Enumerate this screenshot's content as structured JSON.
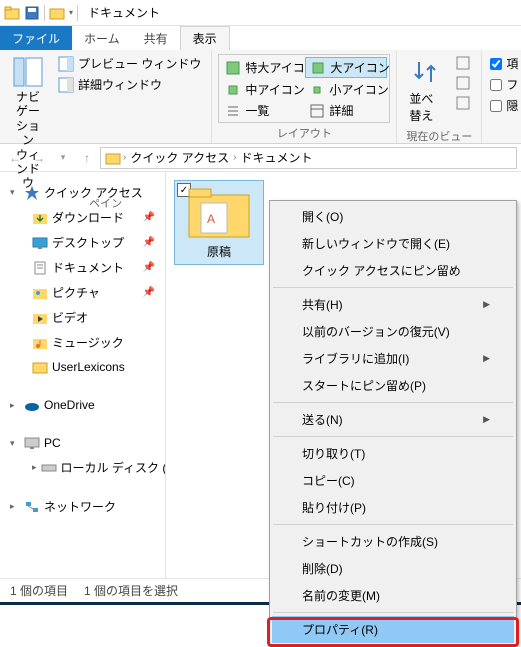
{
  "titlebar": {
    "title": "ドキュメント"
  },
  "tabs": {
    "file": "ファイル",
    "home": "ホーム",
    "share": "共有",
    "view": "表示"
  },
  "ribbon": {
    "pane": {
      "nav": "ナビゲーション\nウィンドウ",
      "preview": "プレビュー ウィンドウ",
      "details": "詳細ウィンドウ",
      "label": "ペイン"
    },
    "layout": {
      "xl": "特大アイコン",
      "l": "大アイコン",
      "m": "中アイコン",
      "s": "小アイコン",
      "list": "一覧",
      "details": "詳細",
      "label": "レイアウト"
    },
    "sort": {
      "button": "並べ替え",
      "label": "現在のビュー"
    },
    "options": {
      "c1": "項",
      "c2": "フ",
      "c3": "隠"
    }
  },
  "breadcrumb": {
    "item1": "クイック アクセス",
    "item2": "ドキュメント"
  },
  "nav": {
    "quick": "クイック アクセス",
    "download": "ダウンロード",
    "desktop": "デスクトップ",
    "documents": "ドキュメント",
    "pictures": "ピクチャ",
    "videos": "ビデオ",
    "music": "ミュージック",
    "userlex": "UserLexicons",
    "onedrive": "OneDrive",
    "pc": "PC",
    "localdisk": "ローカル ディスク (C",
    "network": "ネットワーク"
  },
  "file": {
    "name": "原稿"
  },
  "menu": {
    "open": "開く(O)",
    "open_new": "新しいウィンドウで開く(E)",
    "pin_quick": "クイック アクセスにピン留め",
    "share": "共有(H)",
    "restore": "以前のバージョンの復元(V)",
    "library": "ライブラリに追加(I)",
    "pin_start": "スタートにピン留め(P)",
    "send": "送る(N)",
    "cut": "切り取り(T)",
    "copy": "コピー(C)",
    "paste": "貼り付け(P)",
    "shortcut": "ショートカットの作成(S)",
    "delete": "削除(D)",
    "rename": "名前の変更(M)",
    "properties": "プロパティ(R)"
  },
  "status": {
    "count": "1 個の項目",
    "selected": "1 個の項目を選択"
  }
}
